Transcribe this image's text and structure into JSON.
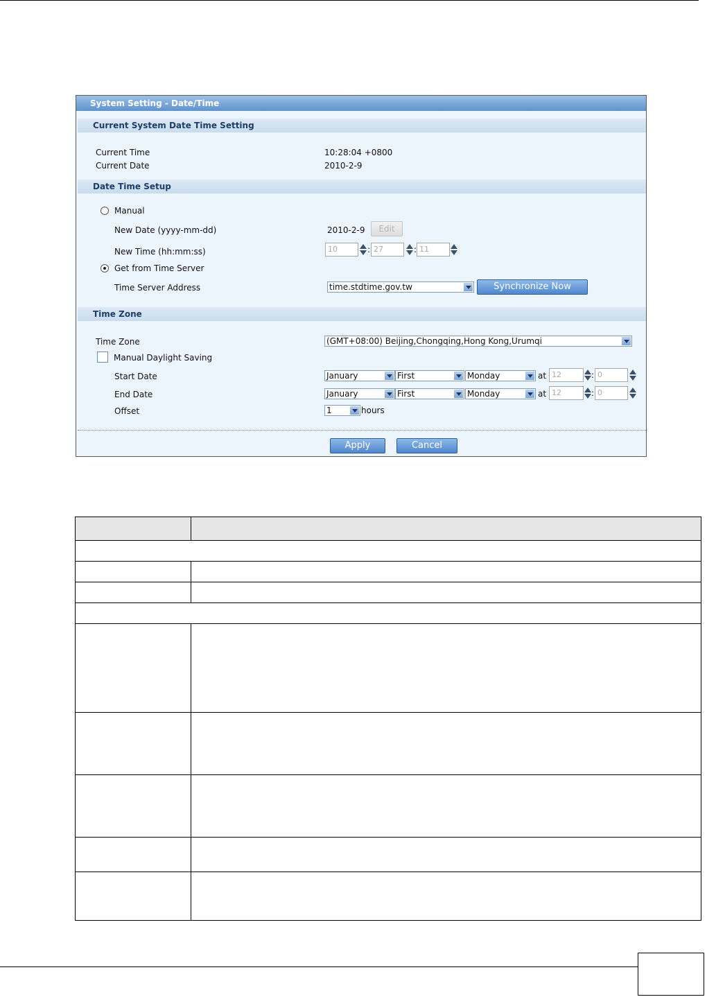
{
  "panel": {
    "title": "System Setting - Date/Time",
    "section_current": "Current System Date Time Setting",
    "current_time_label": "Current Time",
    "current_time_value": "10:28:04 +0800",
    "current_date_label": "Current Date",
    "current_date_value": "2010-2-9",
    "section_setup": "Date Time Setup",
    "manual_label": "Manual",
    "new_date_label": "New Date (yyyy-mm-dd)",
    "new_date_value": "2010-2-9",
    "edit_button": "Edit",
    "new_time_label": "New Time (hh:mm:ss)",
    "time_hh": "10",
    "time_mm": "27",
    "time_ss": "11",
    "get_from_server_label": "Get from Time Server",
    "server_address_label": "Time Server Address",
    "server_address_value": "time.stdtime.gov.tw",
    "sync_button": "Synchronize Now",
    "section_timezone": "Time Zone",
    "timezone_label": "Time Zone",
    "timezone_value": "(GMT+08:00) Beijing,Chongqing,Hong Kong,Urumqi",
    "daylight_label": "Manual Daylight Saving",
    "start_date_label": "Start Date",
    "end_date_label": "End Date",
    "month_value": "January",
    "week_value": "First",
    "day_value": "Monday",
    "at_label": "at",
    "hour_value": "12",
    "minute_value": "0",
    "offset_label": "Offset",
    "offset_value": "1",
    "hours_label": "hours",
    "colon": ":",
    "apply_button": "Apply",
    "cancel_button": "Cancel"
  },
  "colors": {
    "title_bar": "#5f92cc",
    "section_head": "#c9dcee",
    "panel_bg": "#ecf5fb",
    "button": "#4f86cd"
  }
}
